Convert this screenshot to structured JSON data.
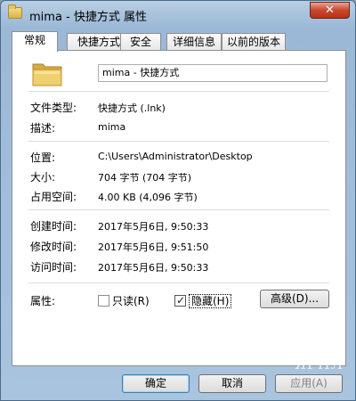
{
  "window": {
    "title": "mima - 快捷方式 属性",
    "close_label": "✕"
  },
  "tabs": [
    {
      "label": "常规",
      "active": true
    },
    {
      "label": "快捷方式",
      "active": false
    },
    {
      "label": "安全",
      "active": false
    },
    {
      "label": "详细信息",
      "active": false
    },
    {
      "label": "以前的版本",
      "active": false
    }
  ],
  "general": {
    "file_name": "mima - 快捷方式",
    "fields": [
      {
        "label": "文件类型:",
        "value": "快捷方式 (.lnk)"
      },
      {
        "label": "描述:",
        "value": "mima"
      },
      {
        "label": "位置:",
        "value": "C:\\Users\\Administrator\\Desktop"
      },
      {
        "label": "大小:",
        "value": "704 字节 (704 字节)"
      },
      {
        "label": "占用空间:",
        "value": "4.00 KB (4,096 字节)"
      },
      {
        "label": "创建时间:",
        "value": "2017年5月6日, 9:50:33"
      },
      {
        "label": "修改时间:",
        "value": "2017年5月6日, 9:51:50"
      },
      {
        "label": "访问时间:",
        "value": "2017年5月6日, 9:50:33"
      }
    ],
    "attributes_label": "属性:",
    "readonly_label": "只读(R)",
    "readonly_checked": false,
    "hidden_label": "隐藏(H)",
    "hidden_checked": true,
    "advanced_label": "高级(D)..."
  },
  "buttons": {
    "ok": "确定",
    "cancel": "取消",
    "apply": "应用(A)"
  },
  "watermark": "ЯРНЛ",
  "colors": {
    "close_button": "#c9462d",
    "folder": "#e7c15c"
  }
}
